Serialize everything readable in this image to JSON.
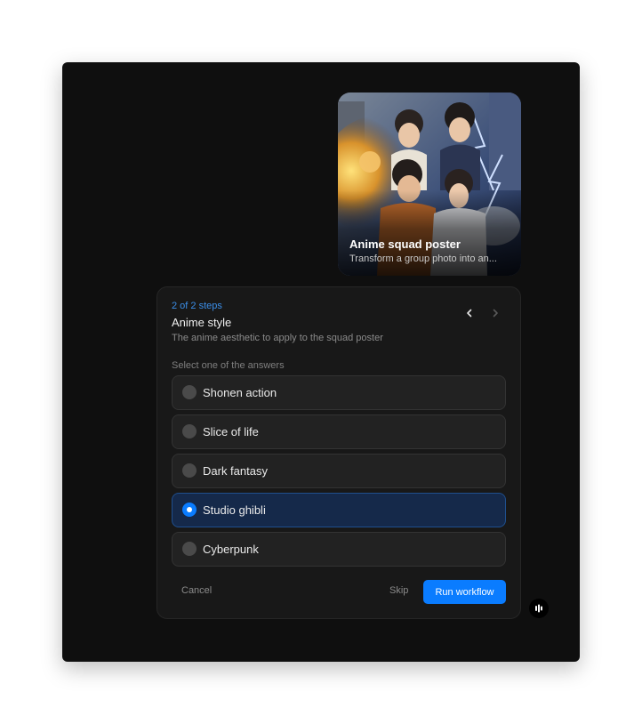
{
  "card": {
    "title": "Anime squad poster",
    "subtitle": "Transform a group photo into an..."
  },
  "panel": {
    "step": "2 of 2 steps",
    "title": "Anime style",
    "description": "The anime aesthetic to apply to the squad poster",
    "select_label": "Select one of the answers",
    "options": [
      {
        "label": "Shonen action",
        "selected": false
      },
      {
        "label": "Slice of life",
        "selected": false
      },
      {
        "label": "Dark fantasy",
        "selected": false
      },
      {
        "label": "Studio ghibli",
        "selected": true
      },
      {
        "label": "Cyberpunk",
        "selected": false
      }
    ],
    "cancel_label": "Cancel",
    "skip_label": "Skip",
    "run_label": "Run workflow"
  },
  "icons": {
    "prev": "chevron-left-icon",
    "next": "chevron-right-icon",
    "fab": "audio-bars-icon"
  },
  "colors": {
    "accent": "#0a7cff",
    "step": "#3b8ee8",
    "selected_bg": "#15294a",
    "window_bg": "#0f0f0f"
  }
}
